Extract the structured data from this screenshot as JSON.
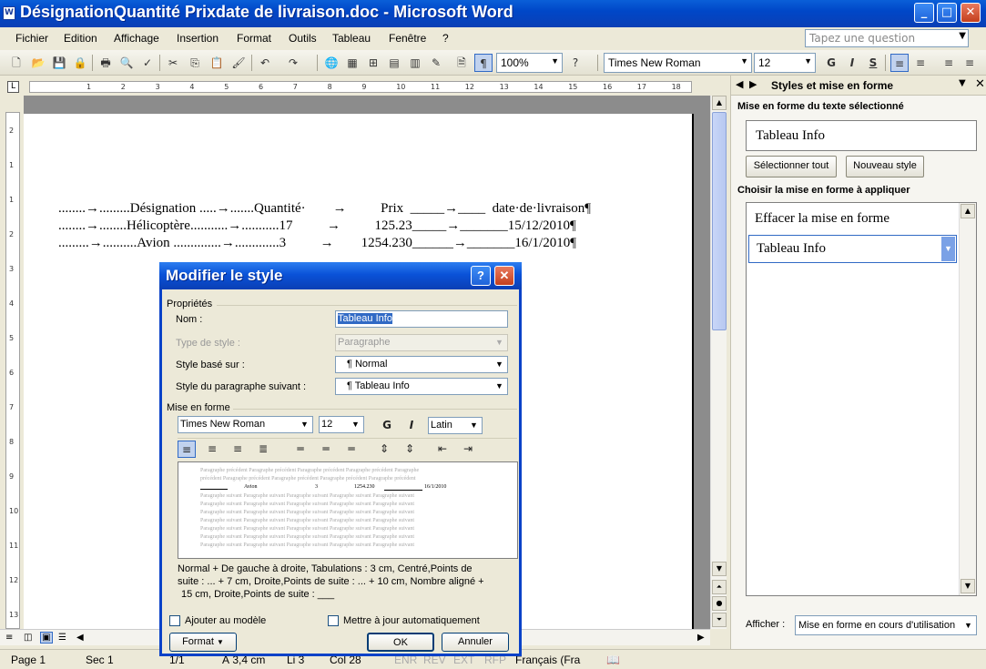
{
  "window": {
    "title": "DésignationQuantité Prixdate de livraison.doc - Microsoft Word",
    "app_icon": "W"
  },
  "menu": [
    "Fichier",
    "Edition",
    "Affichage",
    "Insertion",
    "Format",
    "Outils",
    "Tableau",
    "Fenêtre",
    "?"
  ],
  "ask_box": {
    "placeholder": "Tapez une question"
  },
  "toolbar": {
    "zoom": "100%",
    "font": "Times New Roman",
    "size": "12",
    "bold": "G",
    "italic": "I",
    "strike": "S"
  },
  "ruler": {
    "ticks": [
      "1",
      "2",
      "3",
      "4",
      "5",
      "6",
      "7",
      "8",
      "9",
      "10",
      "11",
      "12",
      "13",
      "14",
      "15",
      "16",
      "17",
      "18"
    ]
  },
  "vruler": {
    "ticks": [
      "2",
      "1",
      "1",
      "2",
      "3",
      "4",
      "5",
      "6",
      "7",
      "8",
      "9",
      "10",
      "11",
      "12",
      "13"
    ]
  },
  "document": {
    "lines": [
      "........→.........Désignation .....→.......Quantité·        →          Prix  _____→____  date·de·livraison¶",
      "........→........Hélicoptère...........→...........17          →          125.23_____→_______15/12/2010¶",
      ".........→..........Avion ..............→.............3          →        1254.230______→_______16/1/2010¶"
    ]
  },
  "status": {
    "page": "Page 1",
    "sec": "Sec 1",
    "pages": "1/1",
    "pos": "À 3,4 cm",
    "line": "Li 3",
    "col": "Col 28",
    "enr": "ENR",
    "rev": "REV",
    "ext": "EXT",
    "rfp": "RFP",
    "lang": "Français (Fra"
  },
  "pane": {
    "title": "Styles et mise en forme",
    "section1": "Mise en forme du texte sélectionné",
    "current_style": "Tableau Info",
    "btn_select_all": "Sélectionner tout",
    "btn_new_style": "Nouveau style",
    "section2": "Choisir la mise en forme à appliquer",
    "styles": [
      "Effacer la mise en forme",
      "Tableau Info"
    ],
    "show_label": "Afficher :",
    "show_value": "Mise en forme en cours d'utilisation"
  },
  "dialog": {
    "title": "Modifier le style",
    "help": "?",
    "properties_label": "Propriétés",
    "name_label": "Nom :",
    "name_value": "Tableau Info",
    "type_label": "Type de style :",
    "type_value": "Paragraphe",
    "based_label": "Style basé sur :",
    "based_value": "¶ Normal",
    "next_label": "Style du paragraphe suivant :",
    "next_value": "¶ Tableau Info",
    "format_label": "Mise en forme",
    "font": "Times New Roman",
    "size": "12",
    "bold": "G",
    "italic": "I",
    "script": "Latin",
    "preview_prev": [
      "Paragraphe précédent Paragraphe précédent Paragraphe précédent Paragraphe précédent Paragraphe",
      "précédent Paragraphe précédent Paragraphe précédent Paragraphe précédent Paragraphe précédent"
    ],
    "preview_sample": {
      "c1": "Avion",
      "c2": "3",
      "c3": "1254.230",
      "c4": "16/1/2010"
    },
    "preview_next": "Paragraphe suivant Paragraphe suivant Paragraphe suivant Paragraphe suivant Paragraphe suivant",
    "description": [
      "Normal + De gauche à droite, Tabulations : 3 cm, Centré,Points de",
      "suite : ...  +  7 cm, Droite,Points de suite : ...  +  10 cm, Nombre aligné  +",
      "15 cm, Droite,Points de suite : ___"
    ],
    "add_template": "Ajouter au modèle",
    "auto_update": "Mettre à jour automatiquement",
    "format_btn": "Format",
    "ok": "OK",
    "cancel": "Annuler"
  }
}
